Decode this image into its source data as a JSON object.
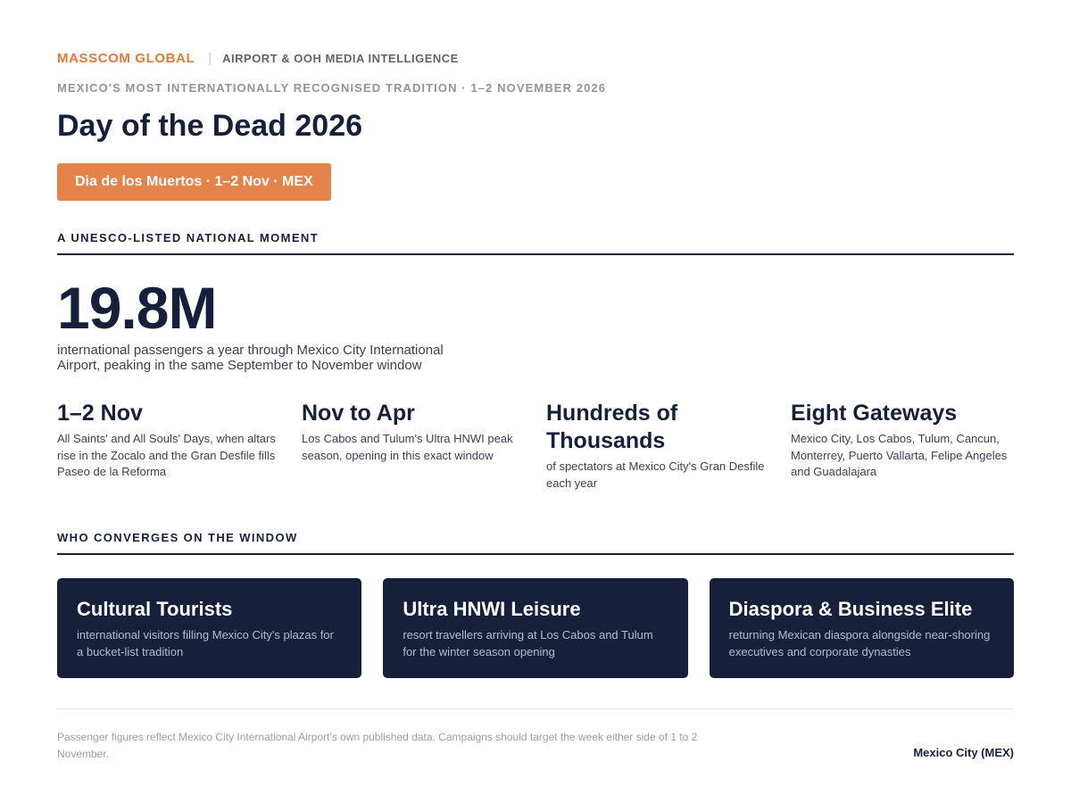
{
  "header": {
    "brand": "MASSCOM GLOBAL",
    "separator": "|",
    "tagline": "AIRPORT & OOH MEDIA INTELLIGENCE",
    "eyebrow": "MEXICO'S MOST INTERNATIONALLY RECOGNISED TRADITION · 1–2 NOVEMBER 2026",
    "title": "Day of the Dead 2026",
    "pill": "Dia de los Muertos · 1–2 Nov · MEX"
  },
  "moment": {
    "section_label": "A UNESCO-LISTED NATIONAL MOMENT",
    "big_stat": "19.8M",
    "big_desc": "international passengers a year through Mexico City International Airport, peaking in the same September to November window",
    "stats": [
      {
        "head": "1–2 Nov",
        "desc": "All Saints' and All Souls' Days, when altars rise in the Zocalo and the Gran Desfile fills Paseo de la Reforma"
      },
      {
        "head": "Nov to Apr",
        "desc": "Los Cabos and Tulum's Ultra HNWI peak season, opening in this exact window"
      },
      {
        "head": "Hundreds of Thousands",
        "desc": "of spectators at Mexico City's Gran Desfile each year"
      },
      {
        "head": "Eight Gateways",
        "desc": "Mexico City, Los Cabos, Tulum, Cancun, Monterrey, Puerto Vallarta, Felipe Angeles and Guadalajara"
      }
    ]
  },
  "audiences": {
    "section_label": "WHO CONVERGES ON THE WINDOW",
    "cards": [
      {
        "title": "Cultural Tourists",
        "desc": "international visitors filling Mexico City's plazas for a bucket-list tradition"
      },
      {
        "title": "Ultra HNWI Leisure",
        "desc": "resort travellers arriving at Los Cabos and Tulum for the winter season opening"
      },
      {
        "title": "Diaspora & Business Elite",
        "desc": "returning Mexican diaspora alongside near-shoring executives and corporate dynasties"
      }
    ]
  },
  "footer": {
    "note": "Passenger figures reflect Mexico City International Airport's own published data. Campaigns should target the week either side of 1 to 2 November.",
    "location": "Mexico City (MEX)"
  },
  "colors": {
    "accent": "#e07a3d",
    "pill": "#e6834a",
    "navy": "#16203a"
  }
}
